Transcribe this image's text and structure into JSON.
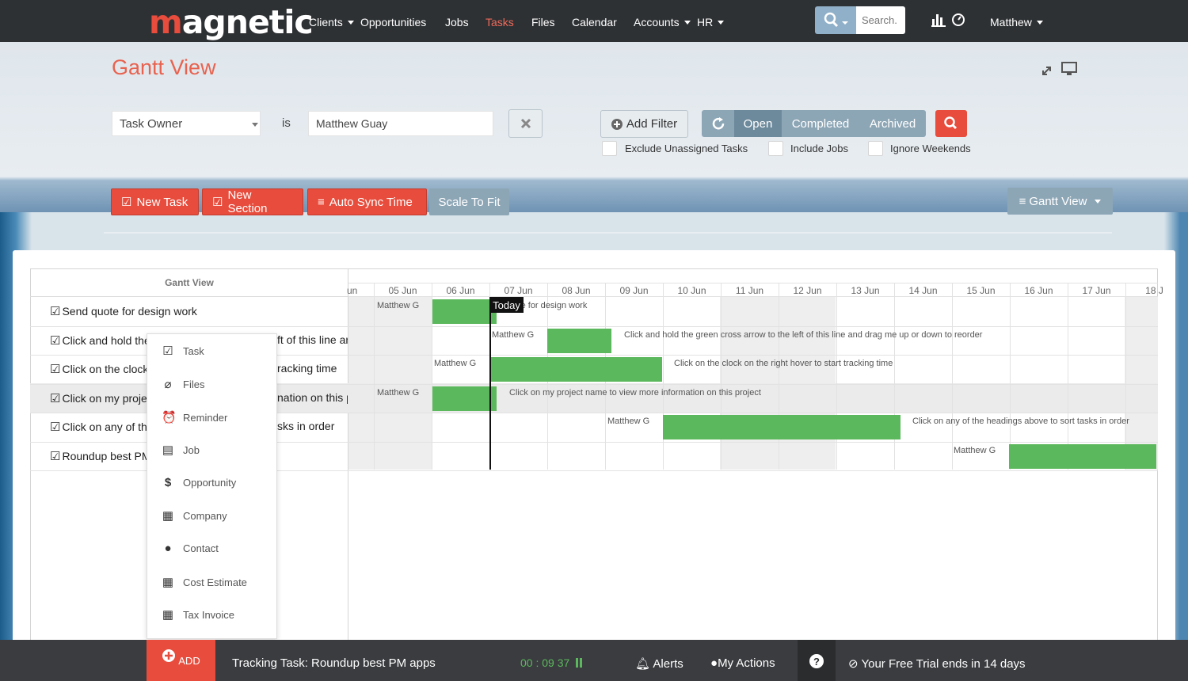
{
  "brand": {
    "name_first": "m",
    "name_rest": "agnetic"
  },
  "nav": {
    "items": [
      {
        "label": "Clients",
        "dropdown": true
      },
      {
        "label": "Opportunities"
      },
      {
        "label": "Jobs"
      },
      {
        "label": "Tasks",
        "active": true
      },
      {
        "label": "Files"
      },
      {
        "label": "Calendar"
      },
      {
        "label": "Accounts",
        "dropdown": true
      },
      {
        "label": "HR",
        "dropdown": true
      }
    ],
    "search_placeholder": "Search.",
    "user": "Matthew"
  },
  "page": {
    "title": "Gantt View"
  },
  "filter": {
    "field": "Task Owner",
    "operator": "is",
    "value": "Matthew Guay",
    "add_filter": "Add Filter",
    "status_options": [
      "Open",
      "Completed",
      "Archived"
    ],
    "status_selected": "Open",
    "checkboxes": [
      "Exclude Unassigned Tasks",
      "Include Jobs",
      "Ignore Weekends"
    ]
  },
  "toolbar": {
    "new_task": "New Task",
    "new_section": "New Section",
    "auto_sync": "Auto Sync Time",
    "scale": "Scale To Fit",
    "view": "Gantt View"
  },
  "gantt": {
    "header": "Gantt View",
    "today_label": "Today",
    "partial_left": "un",
    "days": [
      "05 Jun",
      "06 Jun",
      "07 Jun",
      "08 Jun",
      "09 Jun",
      "10 Jun",
      "11 Jun",
      "12 Jun",
      "13 Jun",
      "14 Jun",
      "15 Jun",
      "16 Jun",
      "17 Jun",
      "18 J"
    ],
    "tasks": [
      {
        "name": "Send quote for design work",
        "tail": "",
        "owner": "Matthew G",
        "bar_label": "d quote for design work"
      },
      {
        "name": "Click and hold the",
        "tail": "ft of this line ar",
        "owner": "Matthew G",
        "bar_label": "Click and hold the green cross arrow to the left of this line and drag me up or down to reorder"
      },
      {
        "name": "Click on the clock",
        "tail": "racking time",
        "owner": "Matthew G",
        "bar_label": "Click on the clock on the right hover to start tracking time"
      },
      {
        "name": "Click on my proje",
        "tail": "nation on this pi",
        "owner": "Matthew G",
        "bar_label": "Click on my project name to view more information on this project"
      },
      {
        "name": "Click on any of th",
        "tail": "sks in order",
        "owner": "Matthew G",
        "bar_label": "Click on any of the headings above to sort tasks in order"
      },
      {
        "name": "Roundup best PM",
        "tail": "",
        "owner": "Matthew G",
        "bar_label": ""
      }
    ]
  },
  "add_menu": {
    "items": [
      "Task",
      "Files",
      "Reminder",
      "Job",
      "Opportunity",
      "Company",
      "Contact",
      "Cost Estimate",
      "Tax Invoice"
    ]
  },
  "footer": {
    "add": "ADD",
    "tracking": "Tracking Task: Roundup best PM apps",
    "timer": "00 : 09 37",
    "alerts": "Alerts",
    "my_actions": "My Actions",
    "help": "?",
    "trial": "Your Free Trial ends in 14 days"
  },
  "colors": {
    "accent": "#e74c3c",
    "bar": "#5cb85c",
    "nav_bg": "#2e3134",
    "segment": "#8da6b6"
  }
}
